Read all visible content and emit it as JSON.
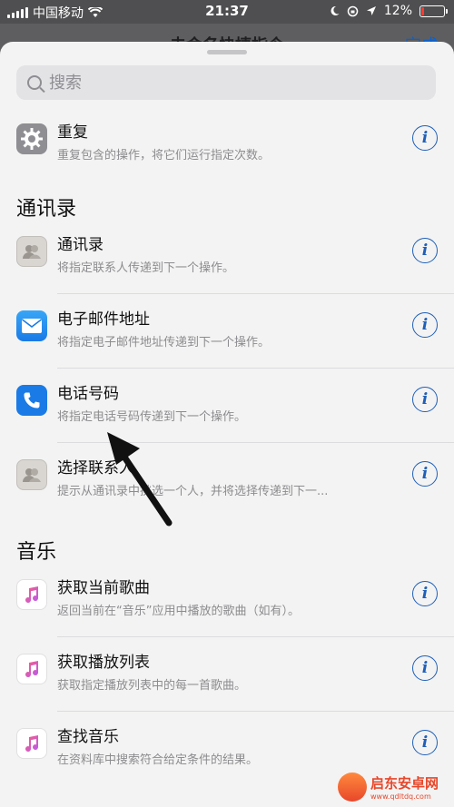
{
  "status_bar": {
    "carrier": "中国移动",
    "time": "21:37",
    "battery": "12%",
    "battery_level": 0.12,
    "battery_color": "#ff3b30"
  },
  "under_header": {
    "title": "未命名快捷指令",
    "done": "完成"
  },
  "search": {
    "placeholder": "搜索"
  },
  "rows_top": [
    {
      "title": "重复",
      "subtitle": "重复包含的操作，将它们运行指定次数。",
      "icon": "gear-icon"
    }
  ],
  "sections": [
    {
      "title": "通讯录",
      "items": [
        {
          "title": "通讯录",
          "subtitle": "将指定联系人传递到下一个操作。",
          "icon": "contacts-icon"
        },
        {
          "title": "电子邮件地址",
          "subtitle": "将指定电子邮件地址传递到下一个操作。",
          "icon": "mail-icon"
        },
        {
          "title": "电话号码",
          "subtitle": "将指定电话号码传递到下一个操作。",
          "icon": "phone-icon"
        },
        {
          "title": "选择联系人",
          "subtitle": "提示从通讯录中挑选一个人，并将选择传递到下一...",
          "icon": "contacts-icon"
        }
      ]
    },
    {
      "title": "音乐",
      "items": [
        {
          "title": "获取当前歌曲",
          "subtitle": "返回当前在“音乐”应用中播放的歌曲（如有）。",
          "icon": "music-icon"
        },
        {
          "title": "获取播放列表",
          "subtitle": "获取指定播放列表中的每一首歌曲。",
          "icon": "music-icon"
        },
        {
          "title": "查找音乐",
          "subtitle": "在资料库中搜索符合给定条件的结果。",
          "icon": "music-icon"
        }
      ]
    }
  ],
  "watermark": {
    "name": "启东安卓网",
    "url": "www.qdltdq.com"
  },
  "colors": {
    "accent": "#1f5fb8"
  }
}
